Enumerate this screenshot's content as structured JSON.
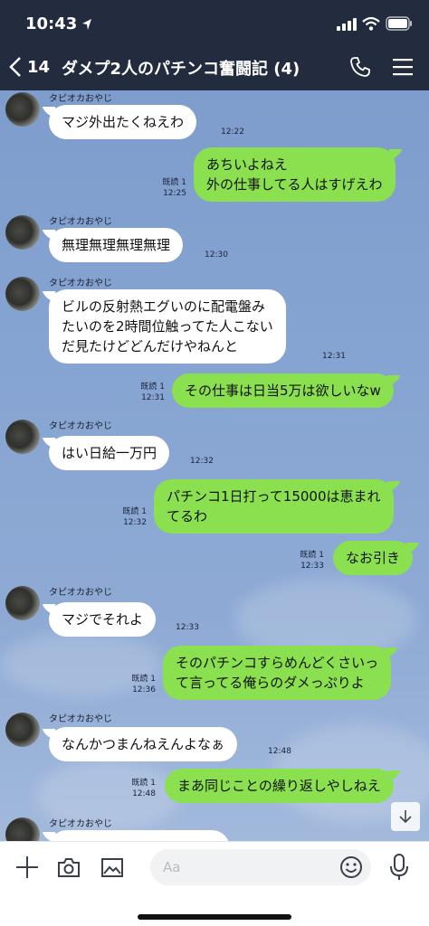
{
  "status_bar": {
    "time": "10:43"
  },
  "header": {
    "back_count": "14",
    "title": "ダメプ2人のパチンコ奮闘記 (4)"
  },
  "messages": [
    {
      "sender": "タピオカおやじ",
      "lines": [
        "マジ外出たくねえわ"
      ],
      "time": "12:22"
    },
    {
      "read": "既読 1",
      "lines": [
        "あちいよねえ",
        "外の仕事してる人はすげえわ"
      ],
      "time": "12:25"
    },
    {
      "sender": "タピオカおやじ",
      "lines": [
        "無理無理無理無理"
      ],
      "time": "12:30"
    },
    {
      "sender": "タピオカおやじ",
      "lines": [
        "ビルの反射熱エグいのに配電盤み",
        "たいのを2時間位触ってた人こない",
        "だ見たけどどんだけやねんと"
      ],
      "time": "12:31"
    },
    {
      "read": "既読 1",
      "lines": [
        "その仕事は日当5万は欲しいなw"
      ],
      "time": "12:31"
    },
    {
      "sender": "タピオカおやじ",
      "lines": [
        "はい日給一万円"
      ],
      "time": "12:32"
    },
    {
      "read": "既読 1",
      "lines": [
        "パチンコ1日打って15000は恵まれ",
        "てるわ"
      ],
      "time": "12:32"
    },
    {
      "read": "既読 1",
      "lines": [
        "なお引き"
      ],
      "time": "12:33"
    },
    {
      "sender": "タピオカおやじ",
      "lines": [
        "マジでそれよ"
      ],
      "time": "12:33"
    },
    {
      "read": "既読 1",
      "lines": [
        "そのパチンコすらめんどくさいっ",
        "て言ってる俺らのダメっぷりよ"
      ],
      "time": "12:36"
    },
    {
      "sender": "タピオカおやじ",
      "lines": [
        "なんかつまんねえんよなぁ"
      ],
      "time": "12:48"
    },
    {
      "read": "既読 1",
      "lines": [
        "まあ同じことの繰り返しやしねえ"
      ],
      "time": "12:48"
    },
    {
      "sender": "タピオカおやじ",
      "lines": [
        ""
      ],
      "time": ""
    }
  ],
  "input": {
    "placeholder": "Aa"
  },
  "colors": {
    "header": "#232b3e",
    "outgoing": "#8ae04f",
    "incoming": "#ffffff",
    "chat_bg": "#86a4d2"
  },
  "icons": [
    "location-arrow-icon",
    "signal-icon",
    "wifi-icon",
    "battery-icon",
    "back-chevron-icon",
    "phone-icon",
    "menu-icon",
    "scroll-down-icon",
    "plus-icon",
    "camera-icon",
    "image-icon",
    "emoji-icon",
    "mic-icon"
  ]
}
